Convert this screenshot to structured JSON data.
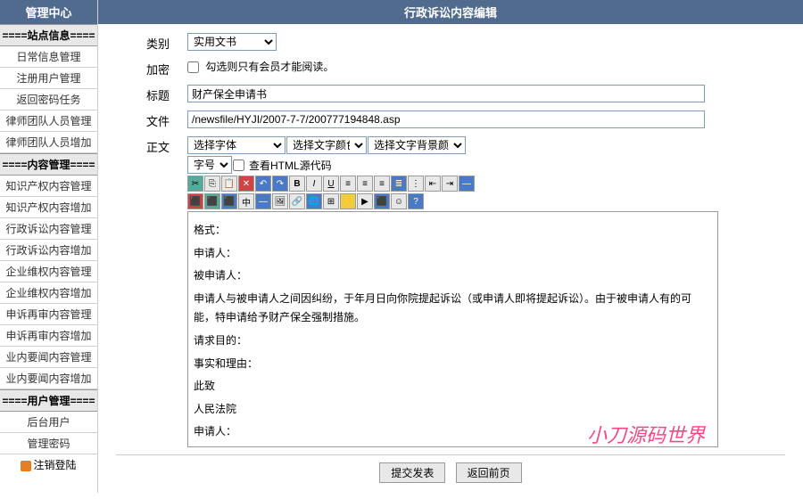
{
  "sidebar": {
    "title": "管理中心",
    "sections": [
      {
        "title": "====站点信息====",
        "items": [
          "日常信息管理",
          "注册用户管理",
          "返回密码任务",
          "律师团队人员管理",
          "律师团队人员增加"
        ]
      },
      {
        "title": "====内容管理====",
        "items": [
          "知识产权内容管理",
          "知识产权内容增加",
          "行政诉讼内容管理",
          "行政诉讼内容增加",
          "企业维权内容管理",
          "企业维权内容增加",
          "申诉再审内容管理",
          "申诉再审内容增加",
          "业内要闻内容管理",
          "业内要闻内容增加"
        ]
      },
      {
        "title": "====用户管理====",
        "items": [
          "后台用户",
          "管理密码"
        ]
      }
    ],
    "logout": "注销登陆"
  },
  "main": {
    "title": "行政诉讼内容编辑",
    "form": {
      "category_label": "类别",
      "category_value": "实用文书",
      "encrypt_label": "加密",
      "encrypt_hint": "勾选则只有会员才能阅读。",
      "title_label": "标题",
      "title_value": "财产保全申请书",
      "file_label": "文件",
      "file_value": "/newsfile/HYJI/2007-7-7/200777194848.asp",
      "content_label": "正文",
      "font_select": "选择字体",
      "color_select": "选择文字颜色",
      "bgcolor_select": "选择文字背景颜色",
      "size_label": "字号",
      "html_source": "查看HTML源代码"
    },
    "editor_body": {
      "l1": "格式：",
      "l2": "申请人：",
      "l3": "被申请人：",
      "l4": "申请人与被申请人之间因纠纷，于年月日向你院提起诉讼（或申请人即将提起诉讼）。由于被申请人有的可能，特申请给予财产保全强制措施。",
      "l5": "请求目的：",
      "l6": "事实和理由：",
      "l7": "此致",
      "l8": "人民法院",
      "l9": "申请人："
    },
    "buttons": {
      "submit": "提交发表",
      "back": "返回前页"
    }
  },
  "watermark": "小刀源码世界"
}
